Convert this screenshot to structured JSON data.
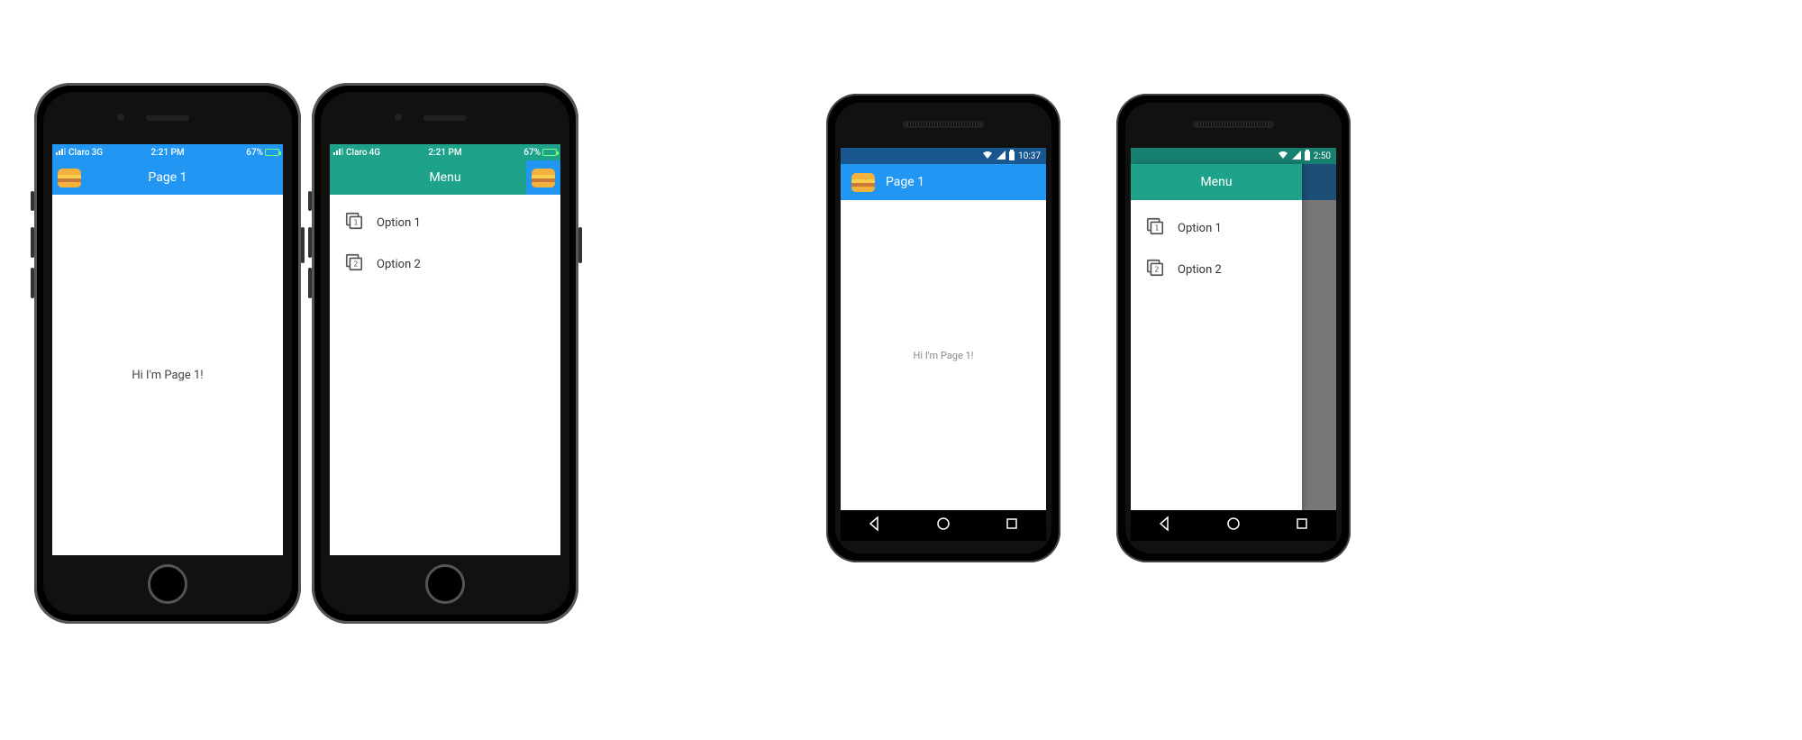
{
  "ios": {
    "phone1": {
      "status": {
        "carrier": "Claro",
        "network": "3G",
        "time": "2:21 PM",
        "battery_pct": "67%"
      },
      "appbar": {
        "title": "Page 1"
      },
      "content": "Hi I'm Page 1!"
    },
    "phone2": {
      "status": {
        "carrier": "Claro",
        "network": "4G",
        "time": "2:21 PM",
        "battery_pct": "67%"
      },
      "appbar": {
        "title": "Menu"
      },
      "menu": {
        "item1": "Option 1",
        "item2": "Option 2"
      }
    }
  },
  "android": {
    "phone1": {
      "status": {
        "time": "10:37"
      },
      "appbar": {
        "title": "Page 1"
      },
      "content": "Hi I'm Page 1!"
    },
    "phone2": {
      "status": {
        "time": "2:50"
      },
      "appbar": {
        "title": "Menu"
      },
      "menu": {
        "item1": "Option 1",
        "item2": "Option 2"
      }
    }
  },
  "colors": {
    "blue": "#2196F3",
    "teal": "#1EA28A"
  }
}
